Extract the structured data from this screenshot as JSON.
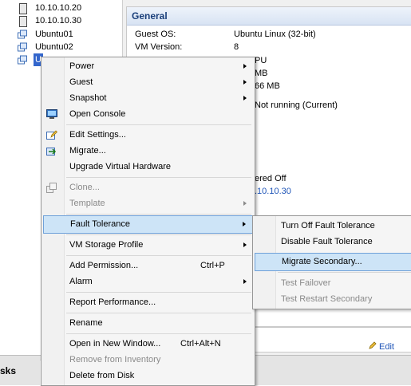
{
  "tree": {
    "items": [
      {
        "label": "10.10.10.20",
        "kind": "host",
        "icon": "host-icon"
      },
      {
        "label": "10.10.10.30",
        "kind": "host",
        "icon": "host-icon"
      },
      {
        "label": "Ubuntu01",
        "kind": "vm",
        "icon": "vm-icon"
      },
      {
        "label": "Ubuntu02",
        "kind": "vm",
        "icon": "vm-icon"
      },
      {
        "label": "U",
        "kind": "vm",
        "icon": "vm-icon",
        "selected": true
      }
    ]
  },
  "details": {
    "section_title": "General",
    "props": [
      {
        "label": "Guest OS:",
        "value": "Ubuntu Linux (32-bit)"
      },
      {
        "label": "VM Version:",
        "value": "8"
      }
    ],
    "partial_values": {
      "cpu": "PU",
      "memory": "MB",
      "overhead": "66 MB",
      "ft_status": "Not running (Current)",
      "state": "ered Off",
      "host": ".10.10.30"
    },
    "edit_label": "Edit"
  },
  "tasks": {
    "label": "sks"
  },
  "context_menu": {
    "power": "Power",
    "guest": "Guest",
    "snapshot": "Snapshot",
    "open_console": "Open Console",
    "edit_settings": "Edit Settings...",
    "migrate": "Migrate...",
    "upgrade_hw": "Upgrade Virtual Hardware",
    "clone": "Clone...",
    "template": "Template",
    "fault_tolerance": "Fault Tolerance",
    "storage_profile": "VM Storage Profile",
    "add_permission": "Add Permission...",
    "add_permission_shortcut": "Ctrl+P",
    "alarm": "Alarm",
    "report_performance": "Report Performance...",
    "rename": "Rename",
    "open_new_window": "Open in New Window...",
    "open_new_window_shortcut": "Ctrl+Alt+N",
    "remove_inventory": "Remove from Inventory",
    "delete_disk": "Delete from Disk"
  },
  "ft_submenu": {
    "turn_off": "Turn Off Fault Tolerance",
    "disable": "Disable Fault Tolerance",
    "migrate_secondary": "Migrate Secondary...",
    "test_failover": "Test Failover",
    "test_restart_secondary": "Test Restart Secondary"
  },
  "colors": {
    "highlight_bg": "#cde4f7",
    "highlight_border": "#6fa1d9",
    "link": "#1f55b8",
    "selection": "#3366cc"
  }
}
